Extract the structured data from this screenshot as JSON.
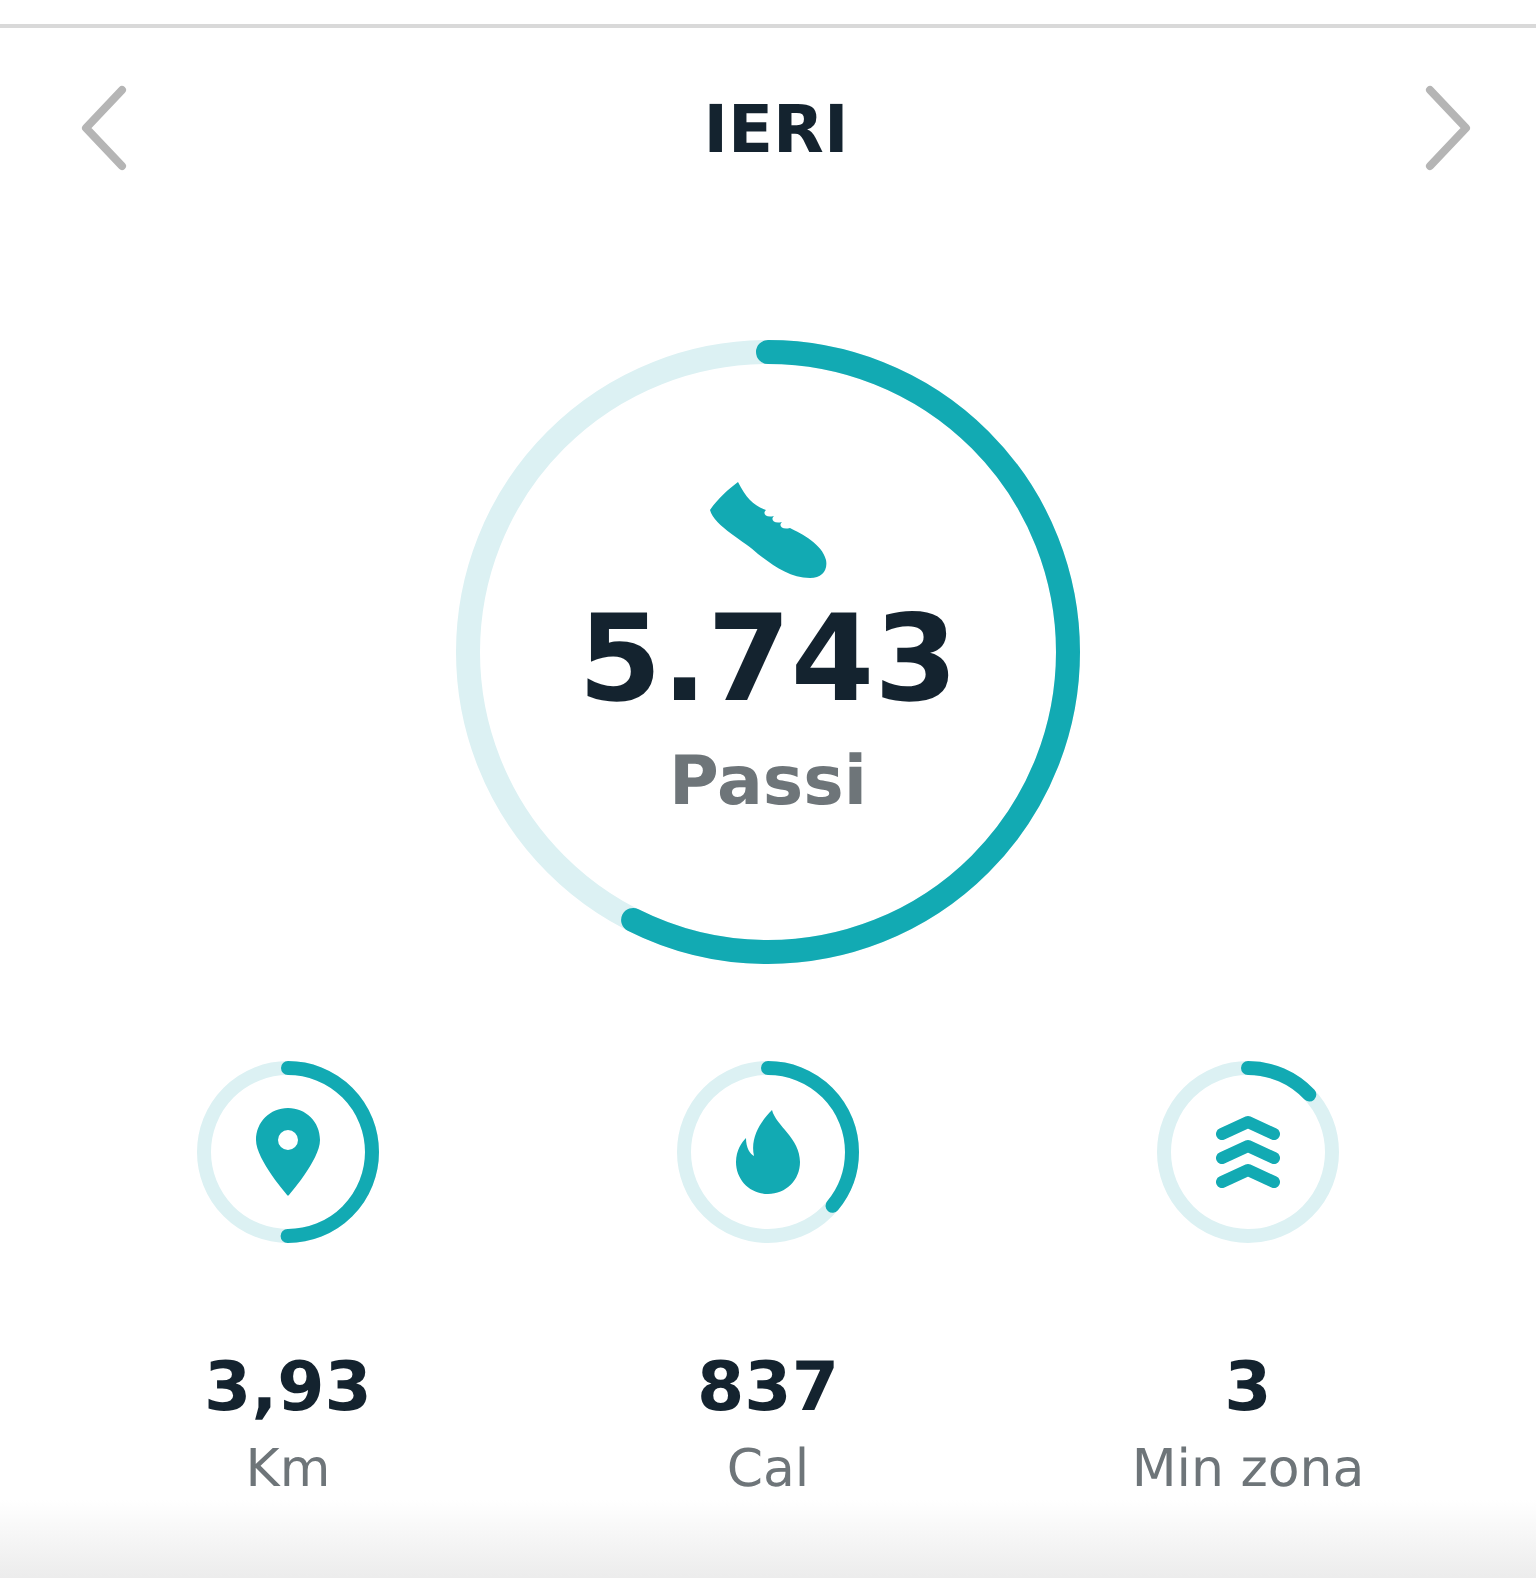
{
  "header": {
    "title": "IERI"
  },
  "main": {
    "value": "5.743",
    "label": "Passi"
  },
  "stats": [
    {
      "kind": "distance",
      "value": "3,93",
      "label": "Km"
    },
    {
      "kind": "calories",
      "value": "837",
      "label": "Cal"
    },
    {
      "kind": "zone",
      "value": "3",
      "label": "Min zona"
    }
  ]
}
